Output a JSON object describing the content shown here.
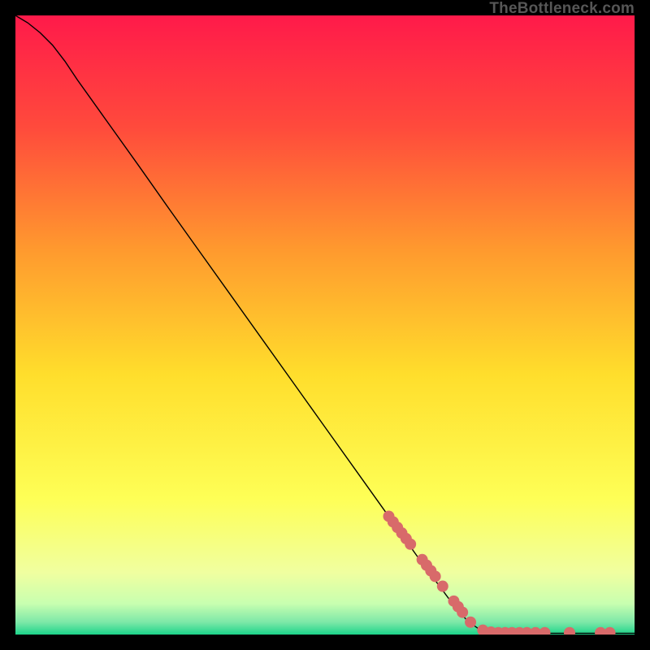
{
  "attribution": "TheBottleneck.com",
  "chart_data": {
    "type": "line",
    "title": "",
    "xlabel": "",
    "ylabel": "",
    "xlim": [
      0,
      100
    ],
    "ylim": [
      0,
      100
    ],
    "grid": false,
    "legend": false,
    "background_gradient": {
      "top": "#ff1a4a",
      "mid_upper": "#ff7a2e",
      "mid": "#ffde2c",
      "mid_lower": "#f5ff6e",
      "near_bottom": "#c8ffb0",
      "bottom": "#1cd48a"
    },
    "series": [
      {
        "name": "curve",
        "type": "line",
        "color": "#000000",
        "width": 1.4,
        "points": [
          {
            "x": 0.0,
            "y": 100.0
          },
          {
            "x": 2.0,
            "y": 98.8
          },
          {
            "x": 4.0,
            "y": 97.2
          },
          {
            "x": 6.0,
            "y": 95.2
          },
          {
            "x": 8.0,
            "y": 92.6
          },
          {
            "x": 10.0,
            "y": 89.6
          },
          {
            "x": 12.0,
            "y": 86.8
          },
          {
            "x": 14.0,
            "y": 84.0
          },
          {
            "x": 16.0,
            "y": 81.2
          },
          {
            "x": 20.0,
            "y": 75.6
          },
          {
            "x": 25.0,
            "y": 68.5
          },
          {
            "x": 30.0,
            "y": 61.5
          },
          {
            "x": 35.0,
            "y": 54.5
          },
          {
            "x": 40.0,
            "y": 47.5
          },
          {
            "x": 45.0,
            "y": 40.5
          },
          {
            "x": 50.0,
            "y": 33.5
          },
          {
            "x": 55.0,
            "y": 26.5
          },
          {
            "x": 60.0,
            "y": 19.5
          },
          {
            "x": 65.0,
            "y": 12.5
          },
          {
            "x": 70.0,
            "y": 5.8
          },
          {
            "x": 73.0,
            "y": 2.2
          },
          {
            "x": 75.0,
            "y": 0.8
          },
          {
            "x": 77.0,
            "y": 0.3
          },
          {
            "x": 80.0,
            "y": 0.2
          },
          {
            "x": 85.0,
            "y": 0.2
          },
          {
            "x": 90.0,
            "y": 0.2
          },
          {
            "x": 95.0,
            "y": 0.2
          },
          {
            "x": 100.0,
            "y": 0.2
          }
        ]
      },
      {
        "name": "highlighted-points",
        "type": "scatter",
        "color": "#d86a6a",
        "radius": 7,
        "points": [
          {
            "x": 60.3,
            "y": 19.1
          },
          {
            "x": 61.0,
            "y": 18.2
          },
          {
            "x": 61.7,
            "y": 17.3
          },
          {
            "x": 62.4,
            "y": 16.4
          },
          {
            "x": 63.1,
            "y": 15.5
          },
          {
            "x": 63.8,
            "y": 14.6
          },
          {
            "x": 65.7,
            "y": 12.1
          },
          {
            "x": 66.4,
            "y": 11.2
          },
          {
            "x": 67.1,
            "y": 10.3
          },
          {
            "x": 67.8,
            "y": 9.4
          },
          {
            "x": 69.0,
            "y": 7.8
          },
          {
            "x": 70.8,
            "y": 5.4
          },
          {
            "x": 71.5,
            "y": 4.5
          },
          {
            "x": 72.2,
            "y": 3.6
          },
          {
            "x": 73.5,
            "y": 2.0
          },
          {
            "x": 75.5,
            "y": 0.7
          },
          {
            "x": 76.8,
            "y": 0.4
          },
          {
            "x": 78.0,
            "y": 0.3
          },
          {
            "x": 79.1,
            "y": 0.3
          },
          {
            "x": 80.2,
            "y": 0.3
          },
          {
            "x": 81.4,
            "y": 0.3
          },
          {
            "x": 82.6,
            "y": 0.3
          },
          {
            "x": 84.0,
            "y": 0.3
          },
          {
            "x": 85.5,
            "y": 0.3
          },
          {
            "x": 89.5,
            "y": 0.3
          },
          {
            "x": 94.5,
            "y": 0.3
          },
          {
            "x": 96.0,
            "y": 0.3
          }
        ]
      }
    ]
  }
}
